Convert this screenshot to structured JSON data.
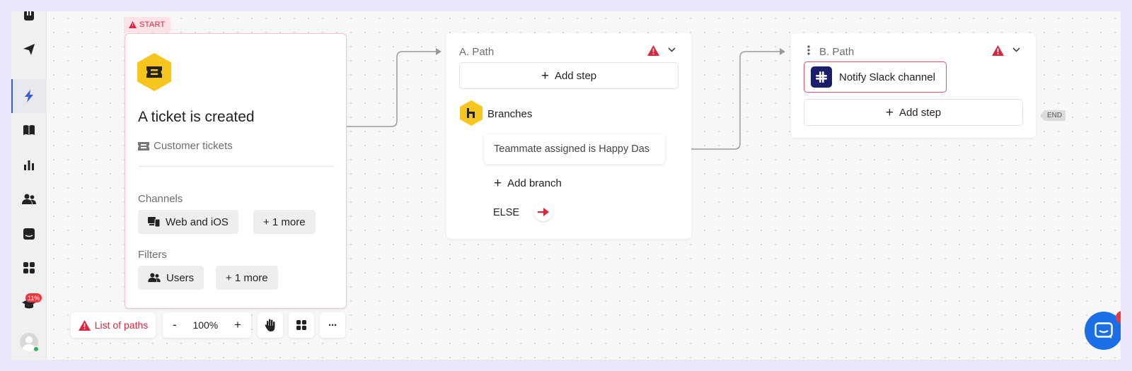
{
  "sidebar": {
    "badge": "11%",
    "active_item": "automation"
  },
  "start_node": {
    "tag": "START",
    "title": "A ticket is created",
    "subtitle": "Customer tickets",
    "channels_label": "Channels",
    "channels_chip": "Web and iOS",
    "channels_more": "+ 1 more",
    "filters_label": "Filters",
    "filters_chip": "Users",
    "filters_more": "+ 1 more"
  },
  "path_a": {
    "title": "A. Path",
    "add_step": "Add step",
    "branches_label": "Branches",
    "branch_condition": "Teammate assigned is Happy Das",
    "add_branch": "Add branch",
    "else_label": "ELSE"
  },
  "path_b": {
    "title": "B. Path",
    "action": "Notify Slack channel",
    "add_step": "Add step",
    "end_tag": "END"
  },
  "toolbar": {
    "list_of_paths": "List of paths",
    "zoom_out": "-",
    "zoom_level": "100%",
    "zoom_in": "+",
    "more": "···"
  },
  "messenger": {
    "notification_count": "1"
  },
  "colors": {
    "accent_yellow": "#f7c51e",
    "error_red": "#d7263d",
    "brand_blue": "#1c6ee6",
    "slack_navy": "#1b1f6b"
  }
}
